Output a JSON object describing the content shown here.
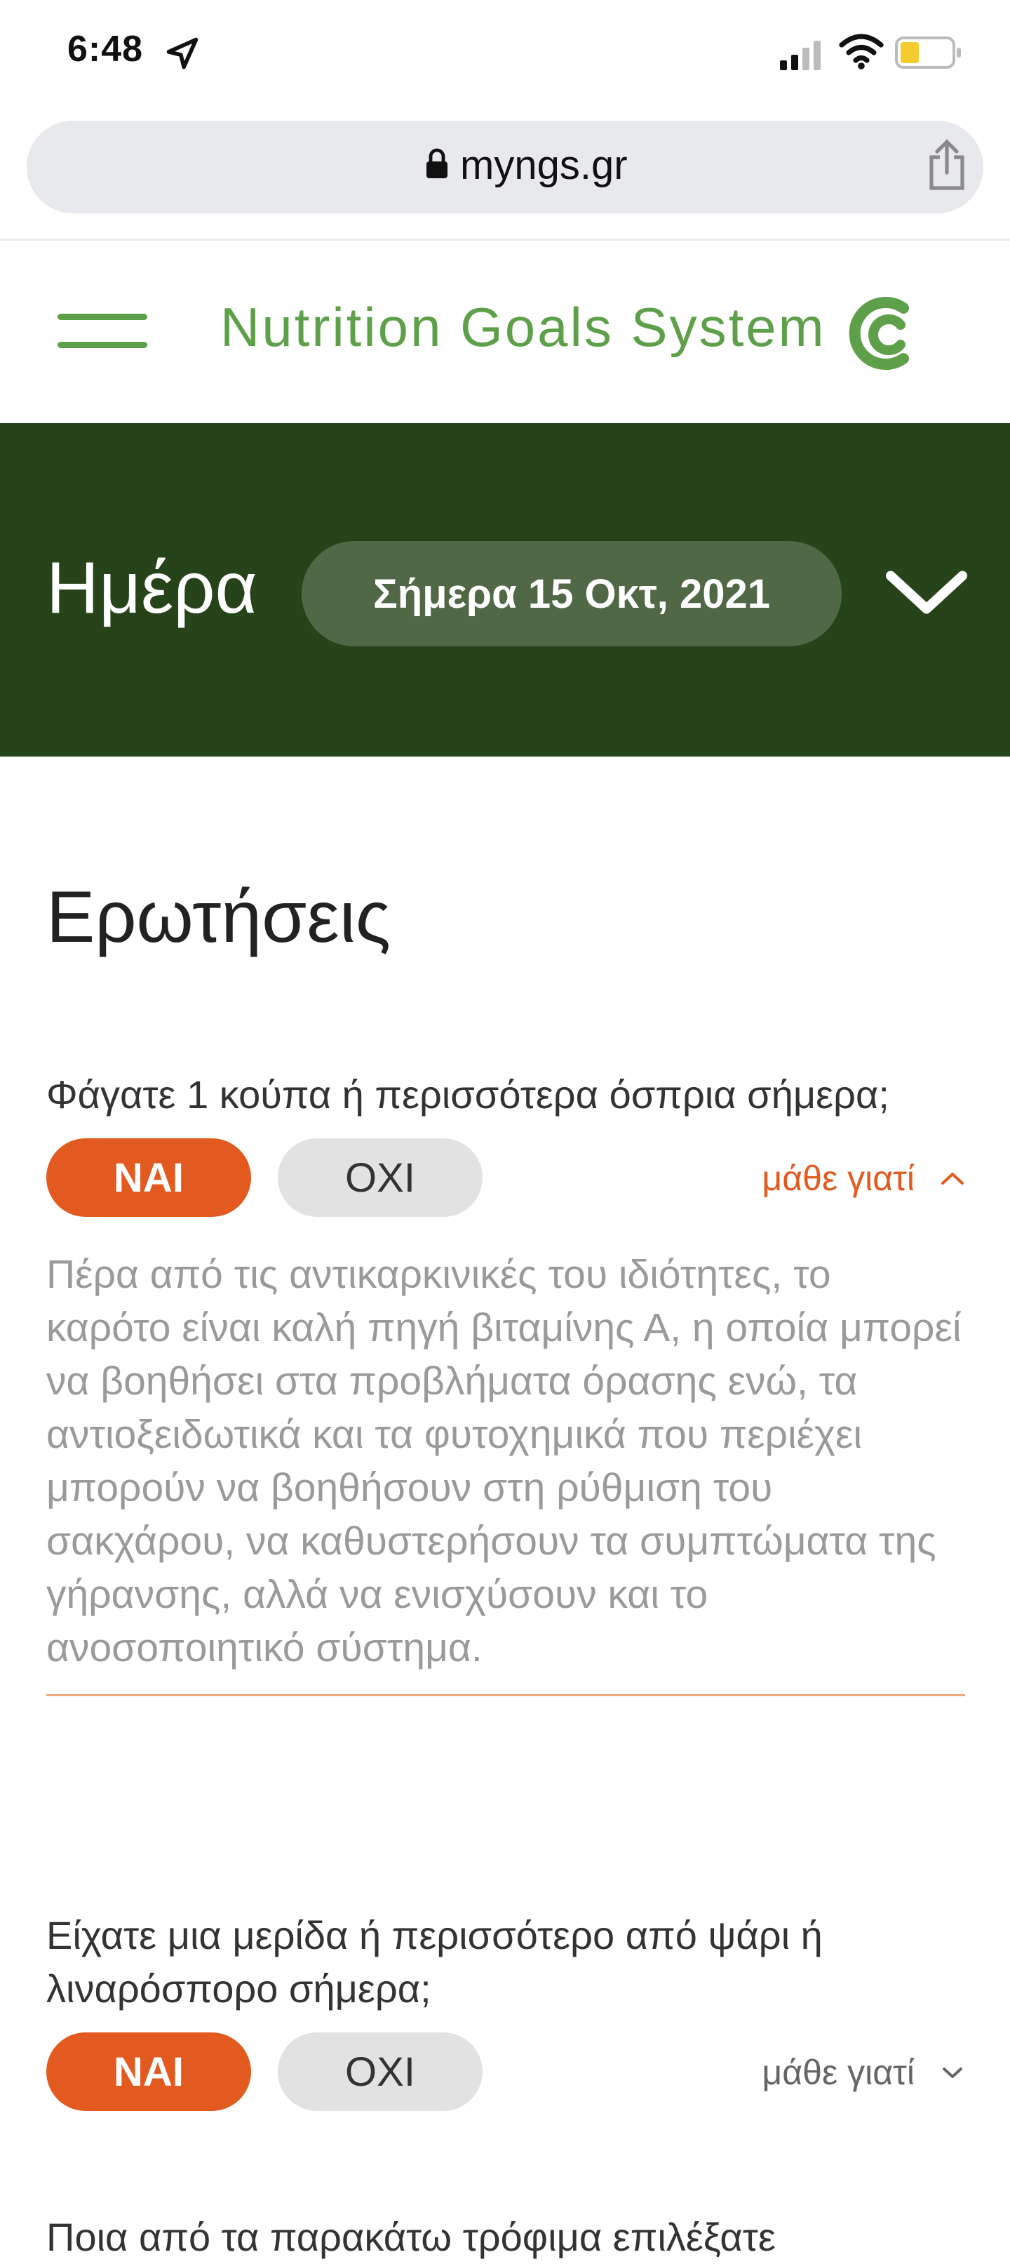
{
  "status_bar": {
    "time": "6:48",
    "icons": [
      "location-arrow-icon",
      "signal-icon",
      "wifi-icon",
      "battery-icon"
    ],
    "battery_color": "#f5cc2e"
  },
  "browser": {
    "url": "myngs.gr"
  },
  "header": {
    "title": "Nutrition Goals System",
    "brand_color": "#5ea04a"
  },
  "day_banner": {
    "label": "Ημέρα",
    "date": "Σήμερα 15 Οκτ, 2021",
    "background": "#26431a"
  },
  "main": {
    "section_title": "Ερωτήσεις",
    "accent_color": "#e35a20",
    "questions": [
      {
        "text": "Φάγατε 1 κούπα ή περισσότερα όσπρια σήμερα;",
        "yes_label": "ΝΑΙ",
        "no_label": "ΟΧΙ",
        "selected": "yes",
        "learn_why_label": "μάθε γιατί",
        "expanded": true,
        "explanation": "Πέρα από τις αντικαρκινικές του ιδιότητες, το καρότο είναι καλή πηγή βιταμίνης Α, η οποία μπορεί να βοηθήσει στα προβλήματα όρασης ενώ, τα αντιοξειδωτικά και τα φυτοχημικά που περιέχει μπορούν να βοηθήσουν στη ρύθμιση του σακχάρου, να καθυστερήσουν τα συμπτώματα της γήρανσης, αλλά να ενισχύσουν και το ανοσοποιητικό σύστημα."
      },
      {
        "text": "Είχατε μια μερίδα ή περισσότερο από ψάρι ή λιναρόσπορο σήμερα;",
        "yes_label": "ΝΑΙ",
        "no_label": "ΟΧΙ",
        "selected": "yes",
        "learn_why_label": "μάθε γιατί",
        "expanded": false
      },
      {
        "text": "Ποια από τα παρακάτω τρόφιμα επιλέξατε"
      }
    ]
  }
}
